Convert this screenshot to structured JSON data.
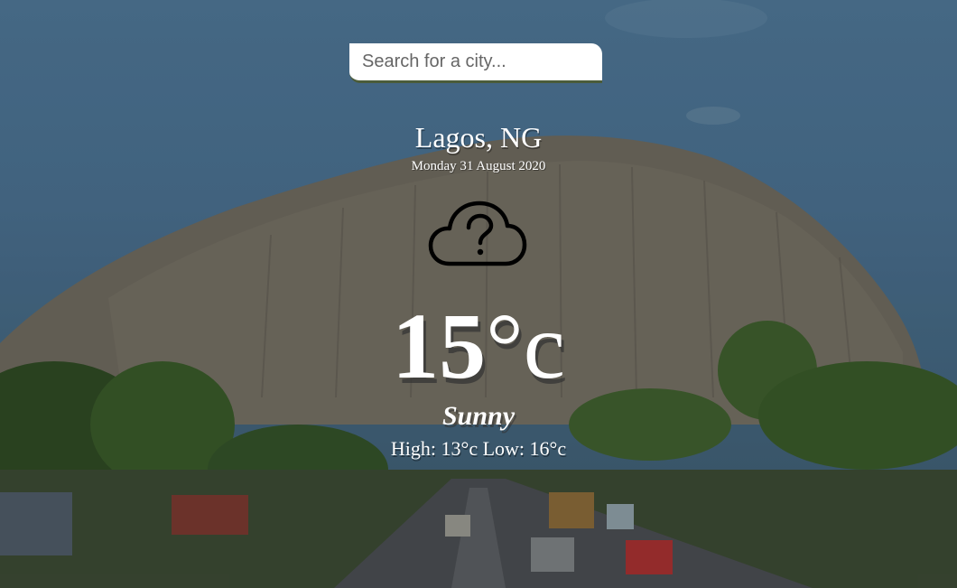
{
  "search": {
    "placeholder": "Search for a city...",
    "value": ""
  },
  "location": {
    "city_country": "Lagos, NG",
    "date": "Monday 31 August 2020"
  },
  "weather": {
    "icon": "cloud-question-icon",
    "temperature": "15",
    "unit": "°c",
    "condition": "Sunny",
    "high_low": "High: 13°c Low: 16°c"
  },
  "colors": {
    "search_underline": "#4b5c3a",
    "text": "#ffffff"
  }
}
